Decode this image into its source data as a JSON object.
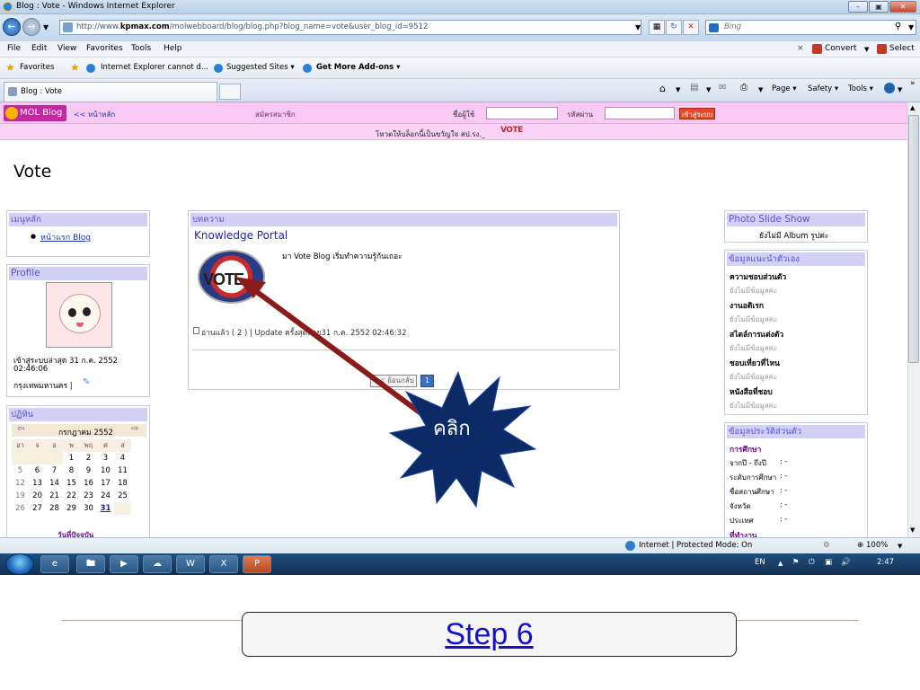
{
  "window": {
    "title": "Blog : Vote - Windows Internet Explorer"
  },
  "address": {
    "url_prefix": "http://www.",
    "url_domain": "kpmax.com",
    "url_path": "/molwebboard/blog/blog.php?blog_name=vote&user_blog_id=9512"
  },
  "search": {
    "placeholder": "Bing"
  },
  "menu": {
    "items": [
      "File",
      "Edit",
      "View",
      "Favorites",
      "Tools",
      "Help"
    ],
    "convert": "Convert",
    "select": "Select"
  },
  "favorites": {
    "label": "Favorites",
    "links": [
      "Internet Explorer cannot d...",
      "Suggested Sites ▾",
      "Get More Add-ons ▾"
    ]
  },
  "tab": {
    "title": "Blog : Vote"
  },
  "command_bar": {
    "page": "Page ▾",
    "safety": "Safety ▾",
    "tools": "Tools ▾"
  },
  "blog_bar": {
    "logo": "MOL Blog",
    "home": "<< หน้าหลัก",
    "register": "สมัครสมาชิก",
    "username_label": "ชื่อผู้ใช้",
    "password_label": "รหัสผ่าน",
    "login_button": "เข้าสู่ระบบ"
  },
  "poll_bar": {
    "text": "โหวตให้บล็อกนี้เป็นขวัญใจ สป.รง._",
    "vote_logo": "VOTE"
  },
  "page_title": "Vote",
  "left": {
    "menu_head": "เมนูหลัก",
    "menu_link": "หน้าแรก Blog",
    "profile_head": "Profile",
    "last_login": "เข้าสู่ระบบล่าสุด 31 ก.ค. 2552",
    "last_login_time": "02:46:06",
    "location": "กรุงเทพมหานคร |",
    "calendar_head": "ปฏิทิน",
    "calendar_month": "กรกฎาคม 2552",
    "weekdays": [
      "อา",
      "จ",
      "อ",
      "พ",
      "พฤ",
      "ศ",
      "ส"
    ],
    "weeks": [
      [
        "",
        "",
        "",
        "1",
        "2",
        "3",
        "4"
      ],
      [
        "5",
        "6",
        "7",
        "8",
        "9",
        "10",
        "11"
      ],
      [
        "12",
        "13",
        "14",
        "15",
        "16",
        "17",
        "18"
      ],
      [
        "19",
        "20",
        "21",
        "22",
        "23",
        "24",
        "25"
      ],
      [
        "26",
        "27",
        "28",
        "29",
        "30",
        "31",
        ""
      ]
    ],
    "calendar_footer": "วันที่ปัจจุบัน"
  },
  "center": {
    "head": "บทความ",
    "article_title": "Knowledge Portal",
    "article_text": "มา Vote Blog เริ่มทำความรู้กันเถอะ",
    "vote_image_text": "VOTE",
    "meta": "อ่านแล้ว ( 2 ) | Update ครั้งสุดท้าย31 ก.ค. 2552 02:46:32",
    "prev_button": "<< ย้อนกลับ",
    "page_number": "1"
  },
  "annotation": {
    "callout": "คลิก"
  },
  "right": {
    "photo_head": "Photo Slide Show",
    "photo_text": "ยังไม่มี Album รูปค่ะ",
    "intro_head": "ข้อมูลแนะนำตัวเอง",
    "intro_items": [
      {
        "label": "ความชอบส่วนตัว",
        "value": "ยังไม่มีข้อมูลค่ะ"
      },
      {
        "label": "งานอดิเรก",
        "value": "ยังไม่มีข้อมูลค่ะ"
      },
      {
        "label": "สไตล์การแต่งตัว",
        "value": "ยังไม่มีข้อมูลค่ะ"
      },
      {
        "label": "ชอบเที่ยวที่ไหน",
        "value": "ยังไม่มีข้อมูลค่ะ"
      },
      {
        "label": "หนังสือที่ชอบ",
        "value": "ยังไม่มีข้อมูลค่ะ"
      }
    ],
    "bio_head": "ข้อมูลประวัติส่วนตัว",
    "edu_label": "การศึกษา",
    "edu_rows": [
      {
        "k": "จากปี - ถึงปี",
        "v": ": -"
      },
      {
        "k": "ระดับการศึกษา",
        "v": ": -"
      },
      {
        "k": "ชื่อสถานศึกษา",
        "v": ": -"
      },
      {
        "k": "จังหวัด",
        "v": ": -"
      },
      {
        "k": "ประเทศ",
        "v": ": -"
      }
    ],
    "work_label": "ที่ทำงาน"
  },
  "status": {
    "zone": "Internet | Protected Mode: On",
    "zoom": "100%"
  },
  "taskbar": {
    "lang": "EN",
    "time": "2:47"
  },
  "slide": {
    "step_label": "Step 6"
  }
}
